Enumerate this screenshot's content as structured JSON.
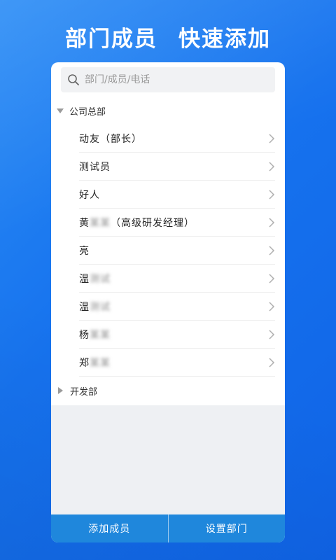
{
  "headline": {
    "part1": "部门成员",
    "part2": "快速添加"
  },
  "search": {
    "placeholder": "部门/成员/电话"
  },
  "departments": [
    {
      "name": "公司总部",
      "expanded": true,
      "members": [
        {
          "name": "动友（部长）",
          "blurred": ""
        },
        {
          "name": "测试员",
          "blurred": ""
        },
        {
          "name": "好人",
          "blurred": ""
        },
        {
          "name": "黄",
          "blurred": "某某",
          "suffix": "（高级研发经理）"
        },
        {
          "name": "亮",
          "blurred": ""
        },
        {
          "name": "温",
          "blurred": "测试"
        },
        {
          "name": "温",
          "blurred": "测试"
        },
        {
          "name": "杨",
          "blurred": "某某"
        },
        {
          "name": "郑",
          "blurred": "某某"
        }
      ]
    },
    {
      "name": "开发部",
      "expanded": false
    }
  ],
  "bottom_bar": {
    "add_member": "添加成员",
    "set_department": "设置部门"
  },
  "colors": {
    "accent": "#1f87dc",
    "background": "#1672ee"
  }
}
